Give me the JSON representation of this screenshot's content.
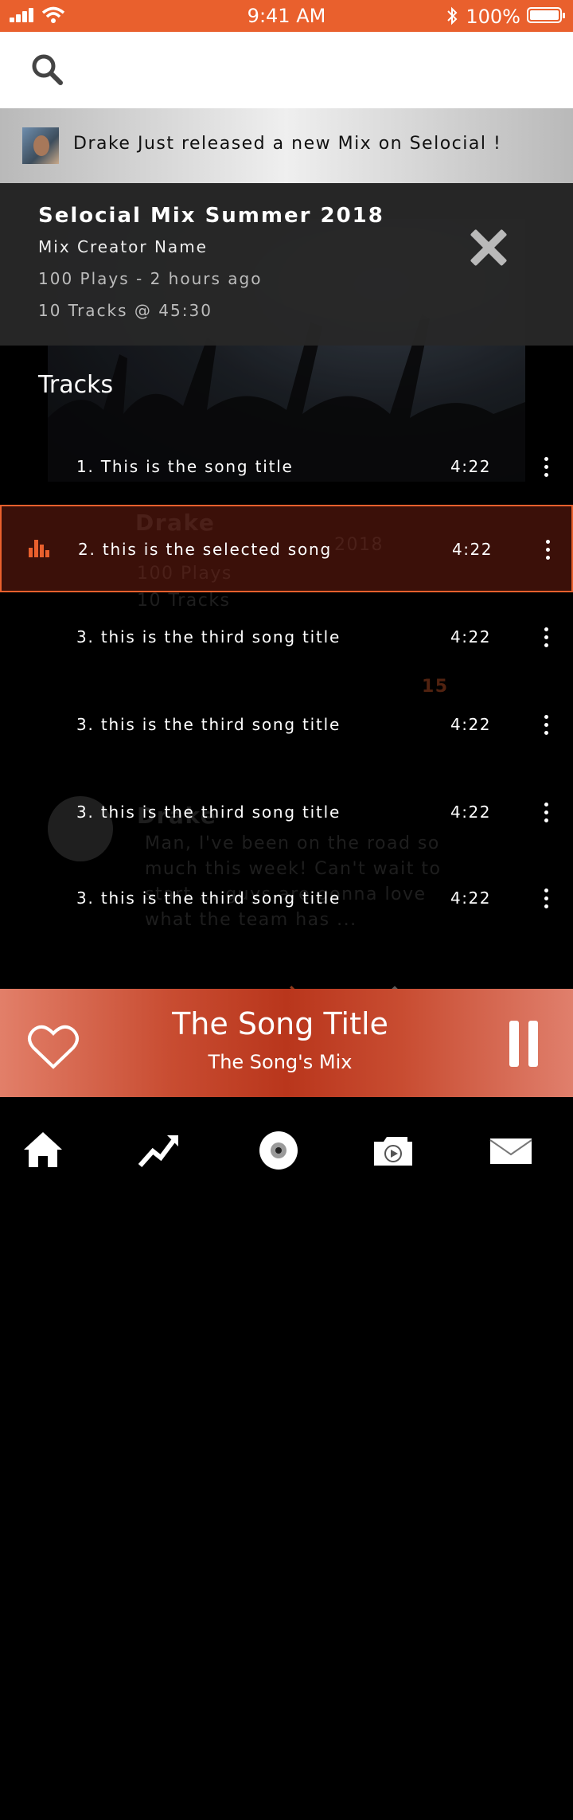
{
  "status_bar": {
    "time": "9:41 AM",
    "battery_percent": "100%",
    "icons": [
      "signal-icon",
      "wifi-icon",
      "bluetooth-icon",
      "battery-icon"
    ]
  },
  "search": {
    "icon": "search-icon"
  },
  "notification": {
    "avatar": "artist-avatar",
    "text": "Drake Just released a new Mix on Selocial !"
  },
  "mix": {
    "title": "Selocial Mix Summer 2018",
    "creator": "Mix Creator Name",
    "plays_line": "100 Plays - 2 hours ago",
    "tracks_line": "10 Tracks @ 45:30",
    "close_icon": "close-icon"
  },
  "tracks": {
    "heading": "Tracks",
    "items": [
      {
        "title": "1. This is the song title",
        "duration": "4:22",
        "selected": false
      },
      {
        "title": "2. this is the selected song",
        "duration": "4:22",
        "selected": true
      },
      {
        "title": "3. this is the third song title",
        "duration": "4:22",
        "selected": false
      },
      {
        "title": "3. this is the third song title",
        "duration": "4:22",
        "selected": false
      },
      {
        "title": "3. this is the third song title",
        "duration": "4:22",
        "selected": false
      },
      {
        "title": "3. this is the third song title",
        "duration": "4:22",
        "selected": false
      }
    ]
  },
  "background_feed": {
    "card1_name": "Drake",
    "card1_line1": "2018",
    "card1_line2": "100 Plays",
    "card1_line3": "10 Tracks",
    "card1_count": "15",
    "card2_name": "Drake",
    "card2_text": "Man, I've been on the road so much this week! Can't wait to start ... guys are gonna love what the team has ..."
  },
  "player": {
    "song_title": "The Song Title",
    "song_mix": "The Song's Mix",
    "accent": "#e9602d"
  },
  "tabbar": {
    "items": [
      "home-icon",
      "trending-icon",
      "disc-icon",
      "video-icon",
      "mail-icon"
    ]
  }
}
